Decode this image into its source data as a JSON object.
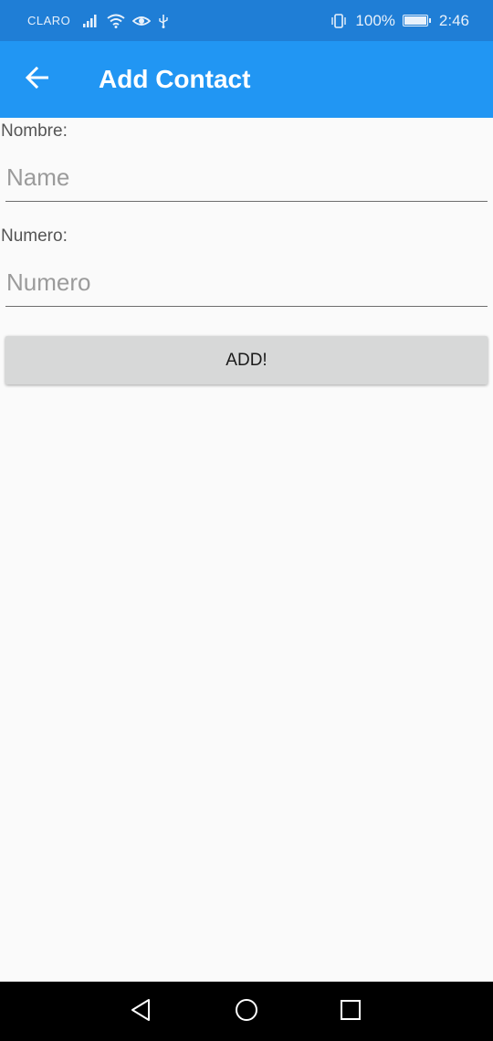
{
  "status_bar": {
    "carrier": "CLARO",
    "battery_percent": "100%",
    "time": "2:46",
    "battery_level": 1.0,
    "icons": [
      "signal-icon",
      "wifi-icon",
      "eye-icon",
      "usb-icon",
      "vibrate-icon",
      "battery-icon"
    ]
  },
  "app_bar": {
    "title": "Add Contact",
    "back_icon": "back-arrow-icon",
    "color": "#2196f3"
  },
  "form": {
    "name_label": "Nombre:",
    "name_placeholder": "Name",
    "name_value": "",
    "number_label": "Numero:",
    "number_placeholder": "Numero",
    "number_value": "",
    "add_button_label": "ADD!"
  },
  "nav_bar": {
    "icons": [
      "back-triangle-icon",
      "home-circle-icon",
      "recents-square-icon"
    ]
  }
}
